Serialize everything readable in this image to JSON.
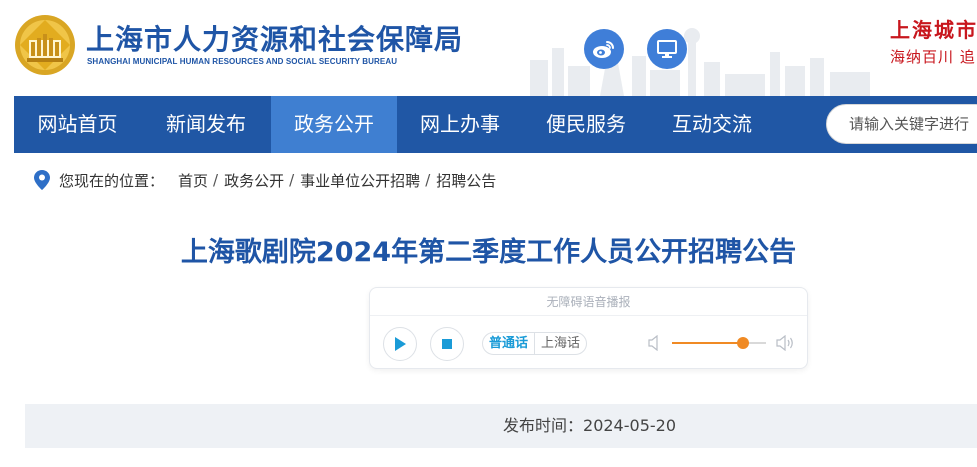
{
  "header": {
    "title": "上海市人力资源和社会保障局",
    "subtitle": "SHANGHAI MUNICIPAL HUMAN RESOURCES AND SOCIAL SECURITY BUREAU",
    "slogan_line1": "上海城市",
    "slogan_line2": "海纳百川 追",
    "weibo_icon": "weibo-icon",
    "pc_icon": "monitor-icon",
    "brand_color": "#1f55a6",
    "slogan_color": "#c8161d"
  },
  "nav": {
    "items": [
      {
        "label": "网站首页"
      },
      {
        "label": "新闻发布"
      },
      {
        "label": "政务公开"
      },
      {
        "label": "网上办事"
      },
      {
        "label": "便民服务"
      },
      {
        "label": "互动交流"
      }
    ],
    "active_index": 2,
    "bar_color": "#2057a5",
    "active_color": "#3f7fd1",
    "search_placeholder": "请输入关键字进行"
  },
  "breadcrumb": {
    "label": "您现在的位置：",
    "items": [
      "首页",
      "政务公开",
      "事业单位公开招聘",
      "招聘公告"
    ],
    "separator": "/"
  },
  "article": {
    "title": "上海歌剧院2024年第二季度工作人员公开招聘公告",
    "publish_label": "发布时间：",
    "publish_date": "2024-05-20"
  },
  "player": {
    "header": "无障碍语音播报",
    "lang_active": "普通话",
    "lang_inactive": "上海话",
    "volume": 0.75,
    "accent_color": "#f08a24"
  }
}
